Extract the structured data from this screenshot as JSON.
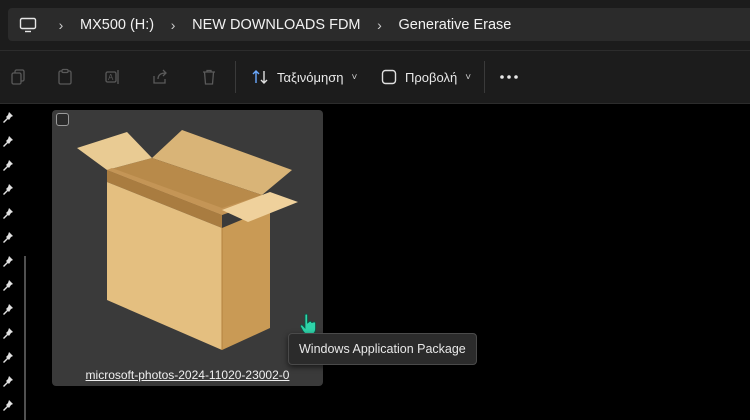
{
  "breadcrumb": {
    "items": [
      {
        "label": "MX500 (H:)"
      },
      {
        "label": "NEW DOWNLOADS FDM"
      },
      {
        "label": "Generative Erase"
      }
    ]
  },
  "toolbar": {
    "sort_label": "Ταξινόμηση",
    "view_label": "Προβολή",
    "icons": [
      "copy-icon",
      "paste-icon",
      "rename-icon",
      "share-icon",
      "delete-icon",
      "sort-icon",
      "view-icon",
      "more-icon"
    ]
  },
  "file": {
    "name": "microsoft-photos-2024-11020-23002-0"
  },
  "tooltip": {
    "text": "Windows Application Package"
  },
  "colors": {
    "background": "#000000",
    "bar": "#1c1c1c",
    "tile": "#3a3a3a",
    "box_light": "#e6c48a",
    "box_dark": "#c99a55",
    "cursor": "#2fd3a9"
  }
}
